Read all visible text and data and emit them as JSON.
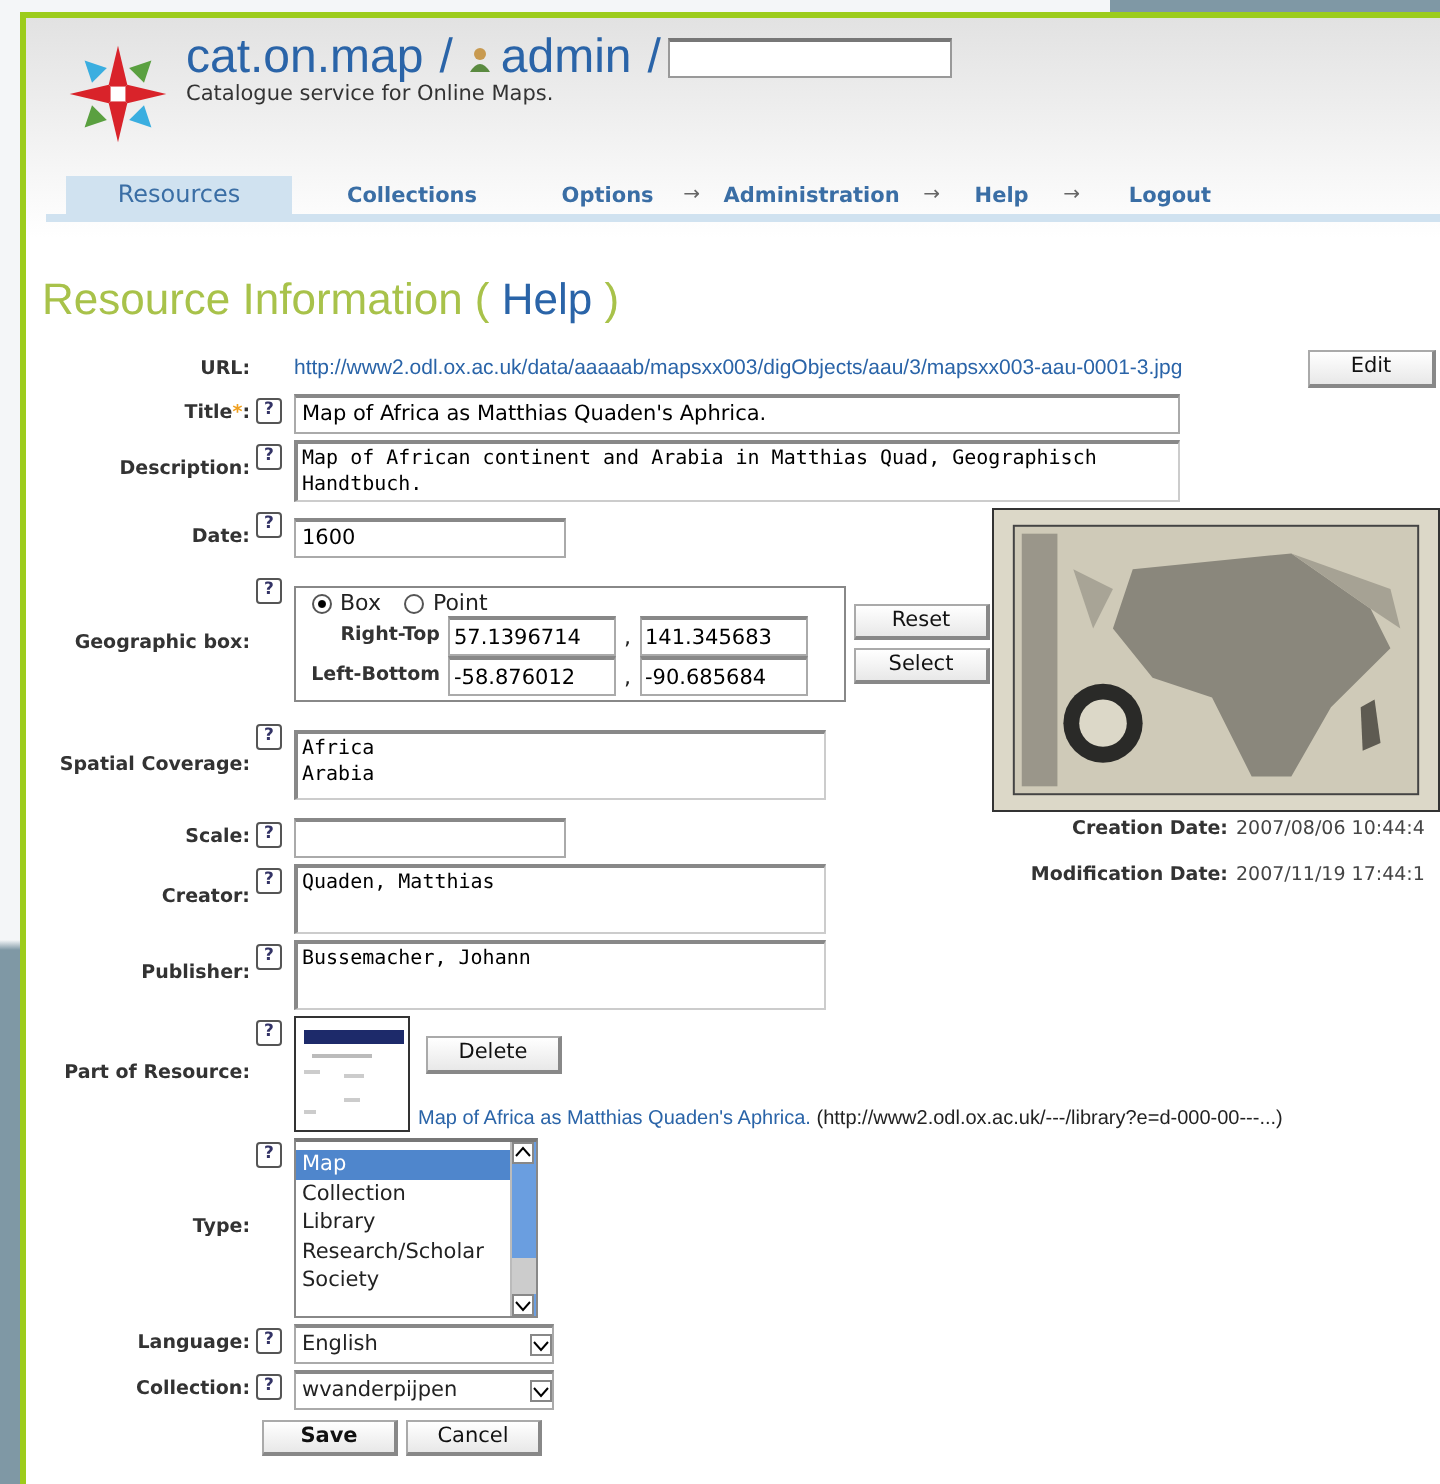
{
  "header": {
    "site": "cat.on.map",
    "sep1": "/",
    "user": "admin",
    "sep2": "/",
    "subtitle": "Catalogue service for Online Maps."
  },
  "nav": [
    {
      "label": "Resources",
      "selected": true
    },
    {
      "label": "Collections",
      "selected": false
    },
    {
      "label": "Options",
      "selected": false,
      "arrow": "→"
    },
    {
      "label": "Administration",
      "selected": false,
      "arrow": "→"
    },
    {
      "label": "Help",
      "selected": false,
      "arrow": "→"
    },
    {
      "label": "Logout",
      "selected": false
    }
  ],
  "heading": {
    "title": "Resource Information (",
    "help_link": "Help",
    "close": ")"
  },
  "fields": [
    {
      "kind": "url",
      "label": "URL:",
      "value": "http://www2.odl.ox.ac.uk/data/aaaaab/mapsxx003/digObjects/aau/3/mapsxx003-aau-0001-3.jpg",
      "button": "Edit"
    },
    {
      "kind": "wide_input",
      "label": "Title",
      "required_mark": "*",
      "label_end": ":",
      "help": "?",
      "value": "Map of Africa as Matthias Quaden's Aphrica."
    },
    {
      "kind": "wide_textarea",
      "label": "Description:",
      "help": "?",
      "value": "Map of African continent and Arabia in Matthias Quad, Geographisch Handtbuch."
    },
    {
      "kind": "input",
      "label": "Date:",
      "help": "?",
      "value": "1600"
    },
    {
      "kind": "geobox",
      "label": "Geographic box:",
      "help": "?",
      "options": [
        {
          "label": "Box",
          "selected": true
        },
        {
          "label": "Point",
          "selected": false
        }
      ],
      "separator": ",",
      "rows": [
        {
          "label": "Right-Top",
          "values": [
            "57.1396714",
            "141.345683"
          ]
        },
        {
          "label": "Left-Bottom",
          "values": [
            "-58.876012",
            "-90.685684"
          ]
        }
      ],
      "buttons": [
        "Reset",
        "Select"
      ]
    },
    {
      "kind": "textarea",
      "label": "Spatial Coverage:",
      "help": "?",
      "value": "Africa\nArabia"
    },
    {
      "kind": "input",
      "label": "Scale:",
      "help": "?"
    },
    {
      "kind": "textarea",
      "label": "Creator:",
      "help": "?",
      "value": "Quaden, Matthias"
    },
    {
      "kind": "textarea",
      "label": "Publisher:",
      "help": "?",
      "value": "Bussemacher, Johann"
    },
    {
      "kind": "part",
      "label": "Part of Resource:",
      "help": "?",
      "button": "Delete",
      "link": "Map of Africa as Matthias Quaden's Aphrica.",
      "link_suffix": "(http://www2.odl.ox.ac.uk/---/library?e=d-000-00---...)"
    },
    {
      "kind": "listbox",
      "label": "Type:",
      "help": "?",
      "options": [
        {
          "label": "Map",
          "selected": true
        },
        {
          "label": "Collection",
          "selected": false
        },
        {
          "label": "Library",
          "selected": false
        },
        {
          "label": "Research/Scholar",
          "selected": false
        },
        {
          "label": "Society",
          "selected": false
        }
      ]
    },
    {
      "kind": "select",
      "label": "Language:",
      "help": "?",
      "value": "English"
    },
    {
      "kind": "select",
      "label": "Collection:",
      "help": "?",
      "value": "wvanderpijpen"
    }
  ],
  "side": {
    "dates": [
      {
        "label": "Creation Date:",
        "value": "2007/08/06 10:44:4"
      },
      {
        "label": "Modification Date:",
        "value": "2007/11/19 17:44:1"
      }
    ]
  },
  "actions": [
    {
      "label": "Save",
      "primary": true
    },
    {
      "label": "Cancel",
      "primary": false
    }
  ]
}
